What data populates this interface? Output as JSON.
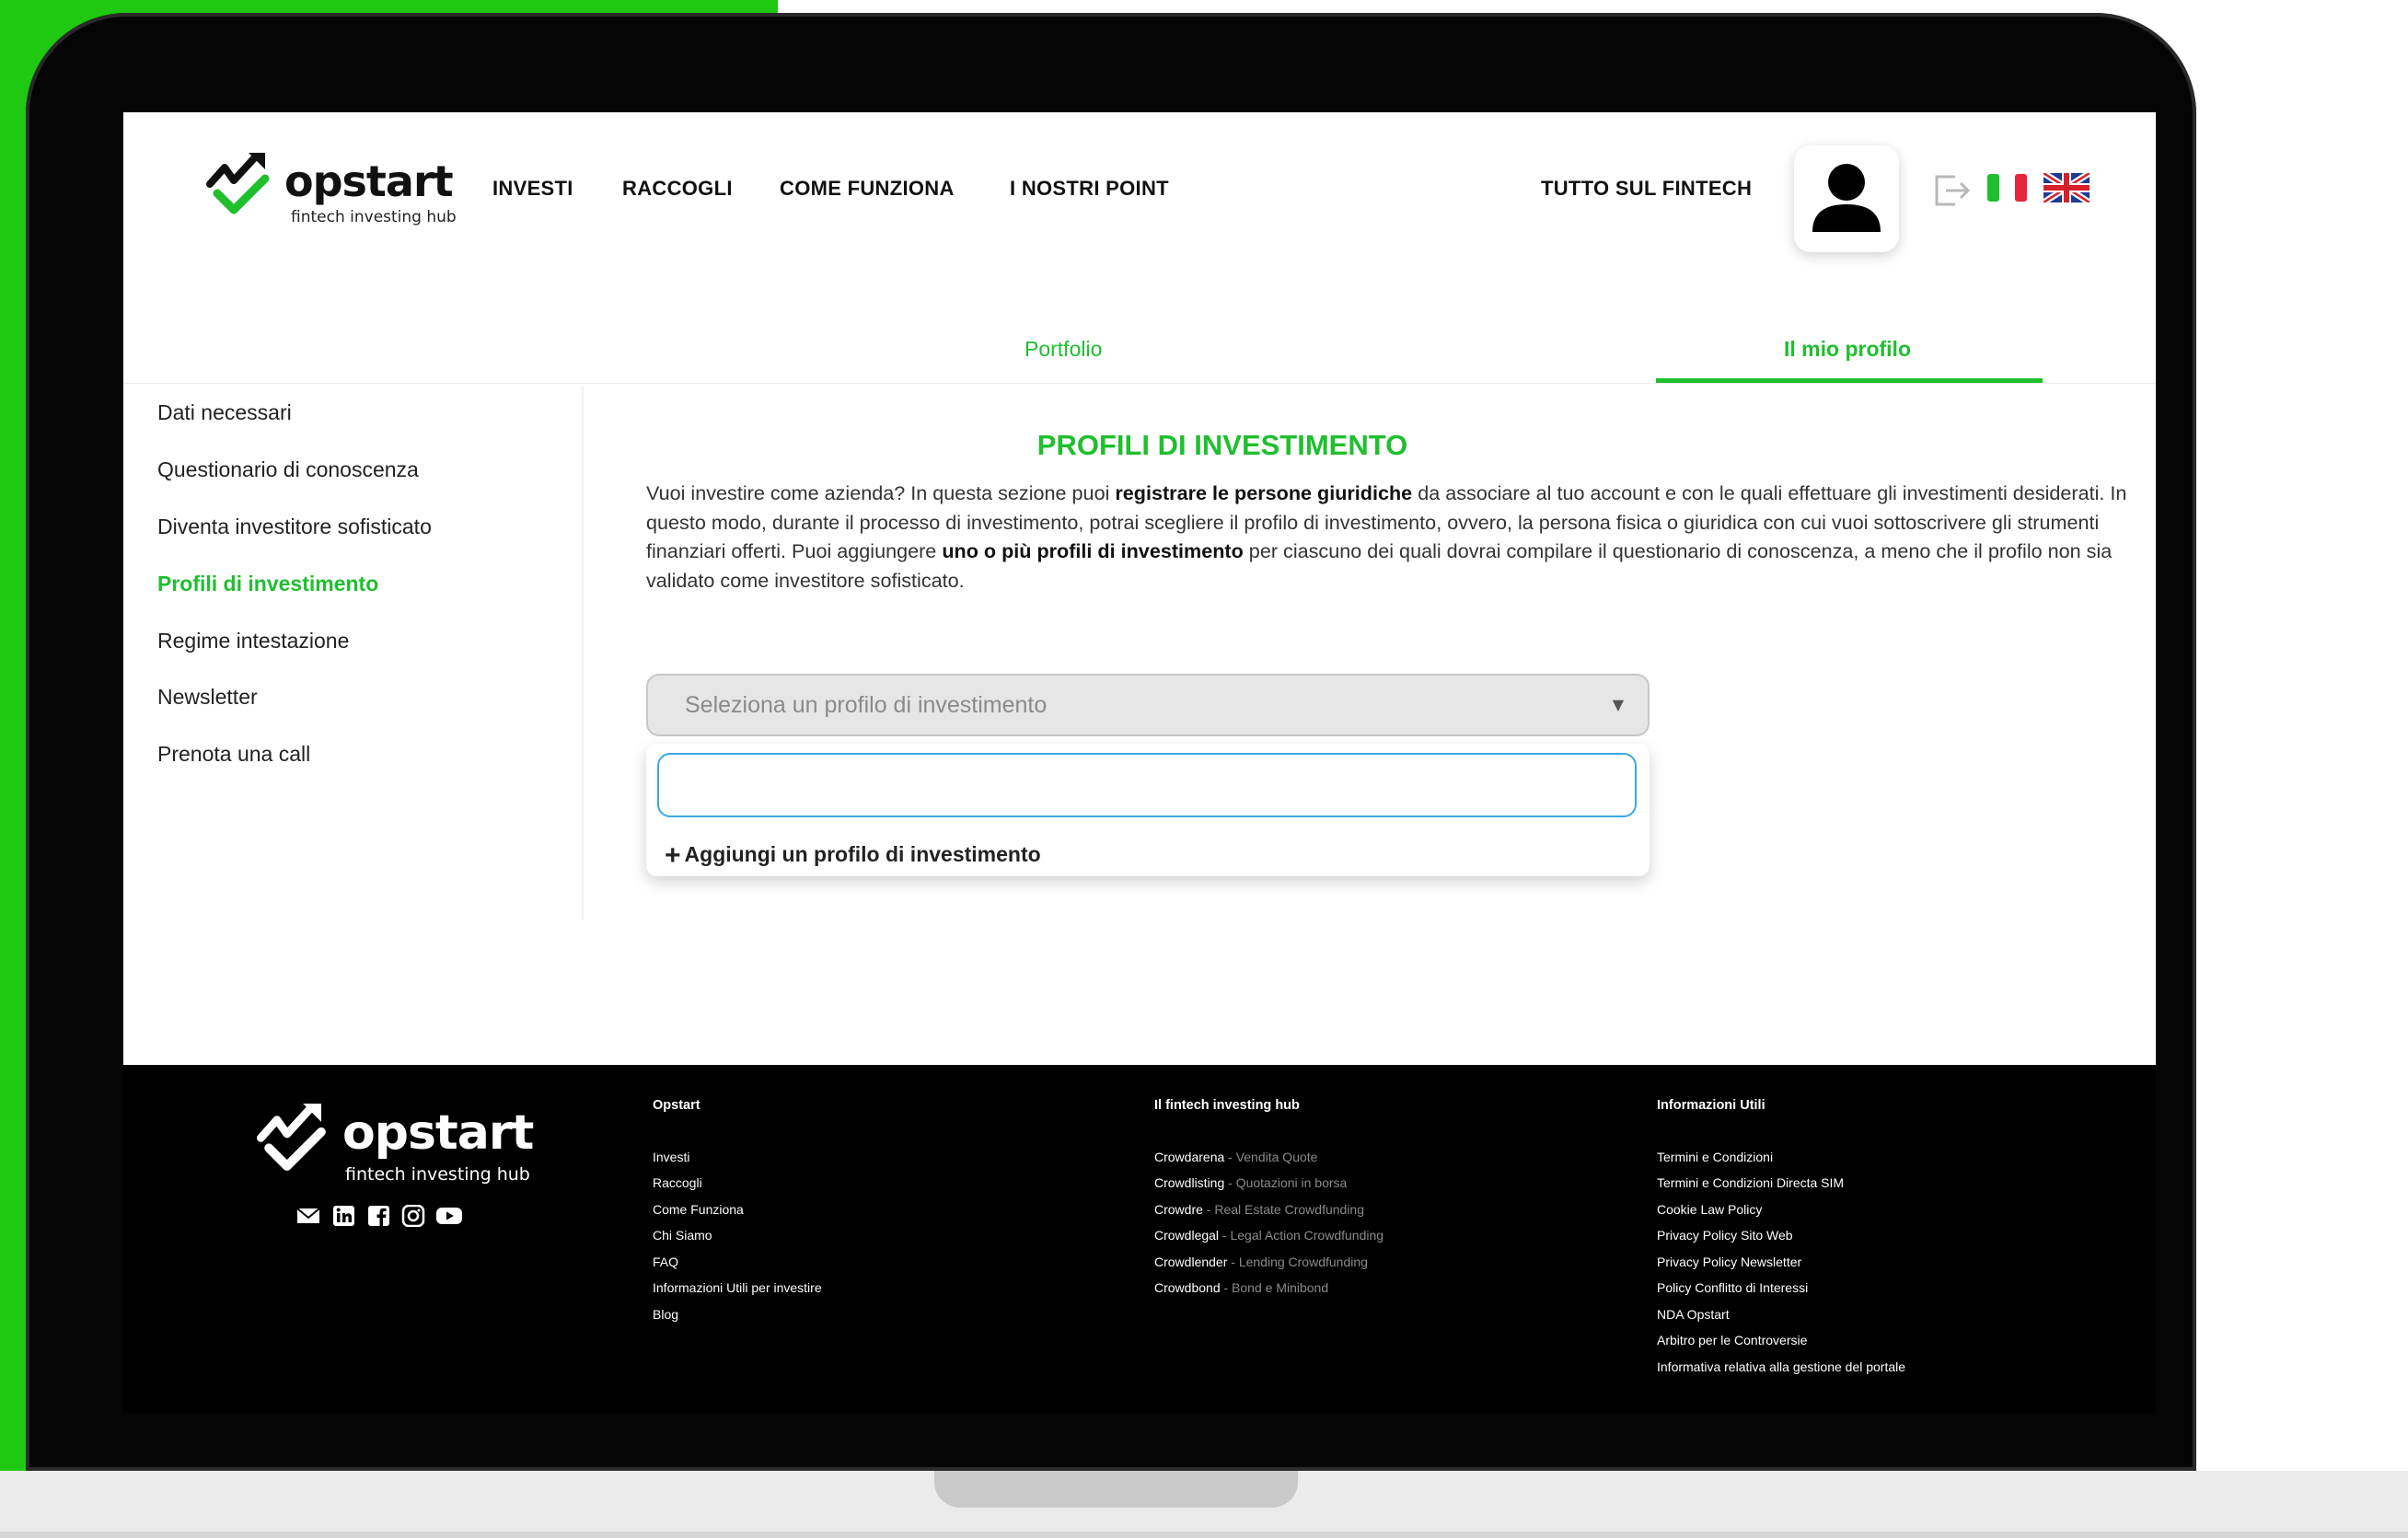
{
  "header": {
    "logo_word": "opstart",
    "logo_tag": "fintech investing hub",
    "nav": [
      "INVESTI",
      "RACCOGLI",
      "COME FUNZIONA",
      "I NOSTRI POINT"
    ],
    "right_link": "TUTTO SUL FINTECH"
  },
  "tabs": [
    "Portfolio",
    "Il mio profilo"
  ],
  "active_tab": "Il mio profilo",
  "sidebar": {
    "items": [
      "Dati necessari",
      "Questionario di conoscenza",
      "Diventa investitore sofisticato",
      "Profili di investimento",
      "Regime intestazione",
      "Newsletter",
      "Prenota una call"
    ],
    "active": "Profili di investimento"
  },
  "main": {
    "title": "PROFILI DI INVESTIMENTO",
    "p1": "Vuoi investire come azienda? In questa sezione puoi ",
    "b1": "registrare le persone giuridiche",
    "p2": " da associare al tuo account e con le quali effettuare gli investimenti desiderati. In questo modo, durante il processo di investimento, potrai scegliere il profilo di investimento, ovvero, la persona fisica o giuridica con cui vuoi sottoscrivere gli strumenti finanziari offerti. Puoi aggiungere ",
    "b2": "uno o più profili di investimento",
    "p3": " per ciascuno dei quali dovrai compilare il questionario di conoscenza, a meno che il profilo non sia validato come investitore sofisticato.",
    "select_placeholder": "Seleziona un profilo di investimento",
    "search_value": "",
    "add_option": "Aggiungi un profilo di investimento"
  },
  "footer": {
    "logo_word": "opstart",
    "logo_tag": "fintech investing hub",
    "social_icons": [
      "mail-icon",
      "linkedin-icon",
      "facebook-icon",
      "instagram-icon",
      "youtube-icon"
    ],
    "col1": {
      "title": "Opstart",
      "links": [
        "Investi",
        "Raccogli",
        "Come Funziona",
        "Chi Siamo",
        "FAQ",
        "Informazioni Utili per investire",
        "Blog"
      ]
    },
    "col2": {
      "title": "Il fintech investing hub",
      "links": [
        {
          "name": "Crowdarena",
          "desc": " - Vendita Quote"
        },
        {
          "name": "Crowdlisting",
          "desc": " - Quotazioni in borsa"
        },
        {
          "name": "Crowdre",
          "desc": " - Real Estate Crowdfunding"
        },
        {
          "name": "Crowdlegal",
          "desc": " - Legal Action Crowdfunding"
        },
        {
          "name": "Crowdlender",
          "desc": " - Lending Crowdfunding"
        },
        {
          "name": "Crowdbond",
          "desc": " - Bond e Minibond"
        }
      ]
    },
    "col3": {
      "title": "Informazioni Utili",
      "links": [
        "Termini e Condizioni",
        "Termini e Condizioni Directa SIM",
        "Cookie Law Policy",
        "Privacy Policy Sito Web",
        "Privacy Policy Newsletter",
        "Policy Conflitto di Interessi",
        "NDA Opstart",
        "Arbitro per le Controversie",
        "Informativa relativa alla gestione del portale"
      ]
    }
  },
  "colors": {
    "brand_green": "#1fbf2e",
    "background_green": "#1fc911",
    "focus_blue": "#3aa7e8"
  }
}
